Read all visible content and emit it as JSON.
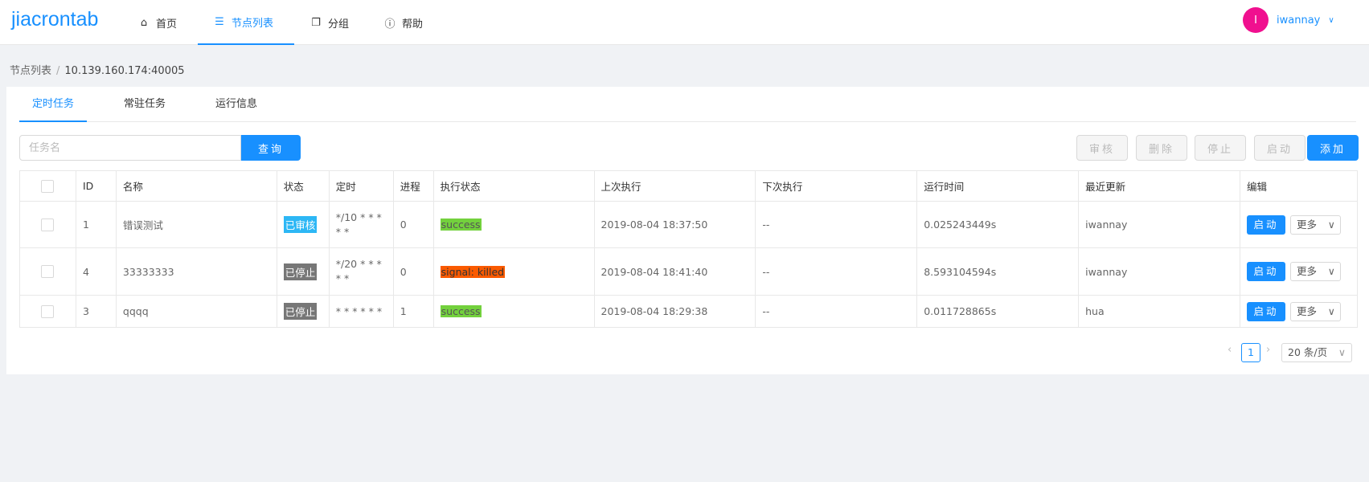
{
  "app": {
    "title": "jiacrontab"
  },
  "nav": [
    {
      "label": "首页",
      "icon": "home-icon"
    },
    {
      "label": "节点列表",
      "icon": "list-icon"
    },
    {
      "label": "分组",
      "icon": "copy-icon"
    },
    {
      "label": "帮助",
      "icon": "info-icon"
    }
  ],
  "user": {
    "initial": "I",
    "name": "iwannay"
  },
  "breadcrumb": {
    "root": "节点列表",
    "separator": "/",
    "current": "10.139.160.174:40005"
  },
  "tabs": [
    "定时任务",
    "常驻任务",
    "运行信息"
  ],
  "toolbar": {
    "search_placeholder": "任务名",
    "query_label": "查询",
    "audit_label": "审核",
    "delete_label": "删除",
    "stop_label": "停止",
    "start_label": "启动",
    "add_label": "添加"
  },
  "table": {
    "headers": [
      "ID",
      "名称",
      "状态",
      "定时",
      "进程",
      "执行状态",
      "上次执行",
      "下次执行",
      "运行时间",
      "最近更新",
      "编辑"
    ],
    "rows": [
      {
        "id": "1",
        "name": "错误测试",
        "status": "已审核",
        "schedule": "*/10 * * * * *",
        "procs": "0",
        "exec_status": "success",
        "last_run": "2019-08-04 18:37:50",
        "next_run": "--",
        "run_time": "0.025243449s",
        "updated_by": "iwannay",
        "start": "启动",
        "more": "更多"
      },
      {
        "id": "4",
        "name": "33333333",
        "status": "已停止",
        "schedule": "*/20 * * * * *",
        "procs": "0",
        "exec_status": "signal: killed",
        "last_run": "2019-08-04 18:41:40",
        "next_run": "--",
        "run_time": "8.593104594s",
        "updated_by": "iwannay",
        "start": "启动",
        "more": "更多"
      },
      {
        "id": "3",
        "name": "qqqq",
        "status": "已停止",
        "schedule": "* * * * * *",
        "procs": "1",
        "exec_status": "success",
        "last_run": "2019-08-04 18:29:38",
        "next_run": "--",
        "run_time": "0.011728865s",
        "updated_by": "hua",
        "start": "启动",
        "more": "更多"
      }
    ]
  },
  "pagination": {
    "current_page": "1",
    "page_size": "20 条/页"
  },
  "colors": {
    "accent": "#1890ff",
    "avatar": "#f0108f",
    "audited": "#2db7f5",
    "stopped": "#777777",
    "success": "#73d13d",
    "killed": "#fa5a00"
  }
}
